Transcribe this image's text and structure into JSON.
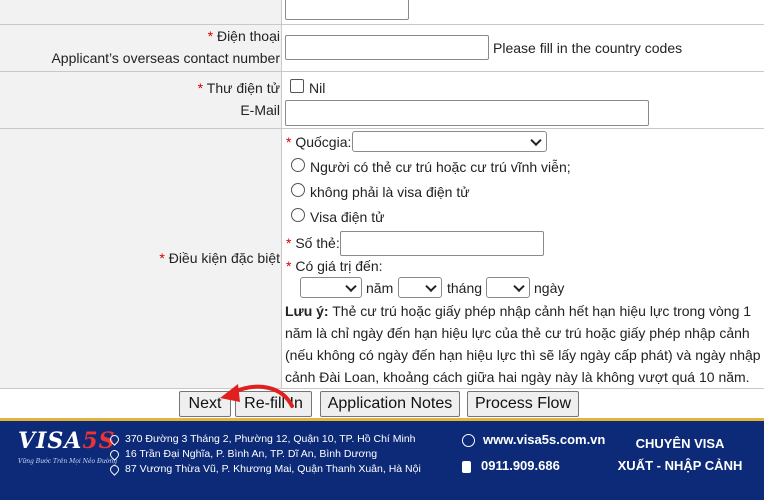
{
  "form": {
    "phone": {
      "required_mark": "*",
      "label_vi": "Điện thoại",
      "label_en": "Applicant’s overseas contact number",
      "hint": "Please fill in the country codes"
    },
    "email": {
      "required_mark": "*",
      "label_vi": "Thư điện tử",
      "label_en": "E-Mail",
      "nil_label": "Nil"
    },
    "special": {
      "required_mark": "*",
      "label": "Điều kiện đặc biệt",
      "country_label": "Quốcgia:",
      "options": [
        "Người có thẻ cư trú hoặc cư trú vĩnh viễn;",
        "không phải là visa điện tử",
        "Visa điện tử"
      ],
      "card_label": "Số thẻ:",
      "valid_label": "Có giá trị đến:",
      "year_label": "năm",
      "month_label": "tháng",
      "day_label": "ngày",
      "note_title": "Lưu ý:",
      "note_lines": [
        "Thẻ cư trú hoặc giấy phép nhập cảnh hết hạn hiệu lực trong vòng 1",
        "năm là chỉ ngày đến hạn hiệu lực của thẻ cư trú hoặc giấy phép nhập cảnh",
        "(nếu không có ngày đến hạn hiệu lực thì sẽ lấy ngày cấp phát) và ngày nhập",
        "cảnh Đài Loan, khoảng cách giữa hai ngày này là không vượt quá 10 năm."
      ]
    }
  },
  "buttons": {
    "next": "Next",
    "refill": "Re-fill In",
    "notes": "Application Notes",
    "flow": "Process Flow"
  },
  "footer": {
    "logo_text": "VISA",
    "logo_num": "5S",
    "logo_tagline": "Vững Bước Trên Mọi Nẻo Đường",
    "addresses": [
      "370 Đường 3 Tháng 2, Phường 12, Quận 10, TP. Hồ Chí Minh",
      "16 Trần Đại Nghĩa, P. Bình An, TP. Dĩ An, Bình Dương",
      "87 Vương Thừa Vũ, P. Khương Mai, Quận Thanh Xuân, Hà Nội"
    ],
    "website": "www.visa5s.com.vn",
    "phone": "0911.909.686",
    "slogan_line1": "CHUYÊN VISA",
    "slogan_line2": "XUẤT - NHẬP CẢNH"
  },
  "colors": {
    "required": "#d40000",
    "footer_bg": "#0c2a78",
    "arrow": "#e02020"
  }
}
